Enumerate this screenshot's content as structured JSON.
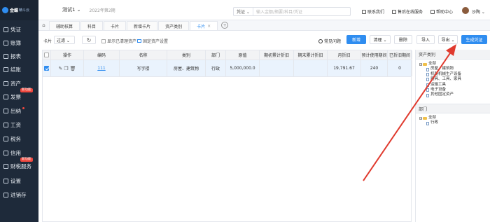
{
  "app": {
    "logo_main": "金蝶",
    "logo_sub": "精斗云"
  },
  "sidebar": {
    "items": [
      {
        "label": "凭证",
        "badge": ""
      },
      {
        "label": "账簿",
        "badge": ""
      },
      {
        "label": "报表",
        "badge": ""
      },
      {
        "label": "结账",
        "badge": ""
      },
      {
        "label": "资产",
        "badge": ""
      },
      {
        "label": "发票",
        "badge": "新功能"
      },
      {
        "label": "出纳",
        "badge": ""
      },
      {
        "label": "工资",
        "badge": ""
      },
      {
        "label": "税务",
        "badge": ""
      },
      {
        "label": "信用",
        "badge": ""
      },
      {
        "label": "财税服务",
        "badge": "新功能"
      },
      {
        "label": "设置",
        "badge": ""
      },
      {
        "label": "进销存",
        "badge": ""
      }
    ]
  },
  "topbar": {
    "account": "测试1 ⌄",
    "period": "2022年第2期",
    "search_type": "凭证 ⌄",
    "search_placeholder": "输入金额/摘要/科目/凭证",
    "links": [
      "联系我们",
      "售后在线服务",
      "帮助中心"
    ],
    "user": "沙陶 ⌄"
  },
  "tabs": {
    "home": "⌂",
    "items": [
      "辅助核算",
      "科目",
      "卡片",
      "新增卡片",
      "资产类别",
      "卡片"
    ],
    "active_index": 5,
    "close": "×",
    "add": "+"
  },
  "toolbar": {
    "card_label": "卡片",
    "filter": "过滤 ⌄",
    "refresh": "↻",
    "show_cleared": "显示已清理资产",
    "fixed_settings": "固定资产设置",
    "faq": "常见问题",
    "buttons": {
      "add": "新增",
      "clear": "清理 ⌄",
      "delete": "删除",
      "import": "导入",
      "export": "导出 ⌄",
      "generate": "生成凭证"
    }
  },
  "table": {
    "headers": [
      "",
      "操作",
      "编码",
      "名称",
      "类别",
      "部门",
      "原值",
      "期初累计折旧",
      "期末累计折旧",
      "月折旧",
      "预计使用期间",
      "已折旧期间"
    ],
    "rows": [
      {
        "checked": true,
        "code": "111",
        "name": "写字楼",
        "category": "房屋、建筑物",
        "dept": "行政",
        "original": "5,000,000.0",
        "open_dep": "",
        "close_dep": "",
        "monthly": "19,791.67",
        "life": "240",
        "used": "0"
      }
    ]
  },
  "right_panel": {
    "category_title": "资产类别",
    "category_tree": [
      "全部",
      "房屋、建筑物",
      "机器机械生产设备",
      "器具、工具、家具",
      "运输工具",
      "电子设备",
      "其他固定资产"
    ],
    "dept_title": "部门",
    "dept_tree": [
      "全部",
      "行政"
    ]
  },
  "colors": {
    "primary": "#2f8df0",
    "sidebar": "#1e2a3a",
    "badge": "#f0483e",
    "arrow": "#e03a2e"
  }
}
